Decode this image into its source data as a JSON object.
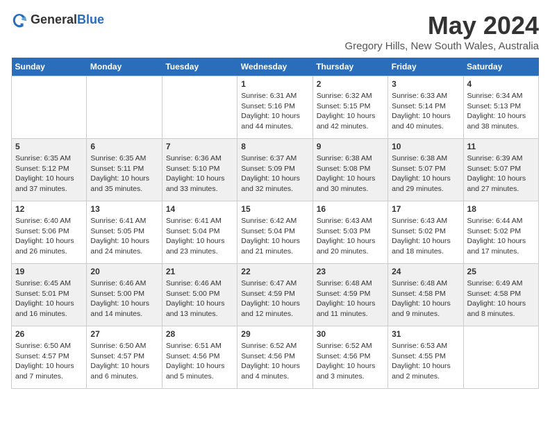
{
  "logo": {
    "general": "General",
    "blue": "Blue"
  },
  "title": "May 2024",
  "subtitle": "Gregory Hills, New South Wales, Australia",
  "headers": [
    "Sunday",
    "Monday",
    "Tuesday",
    "Wednesday",
    "Thursday",
    "Friday",
    "Saturday"
  ],
  "weeks": [
    [
      {
        "day": "",
        "info": ""
      },
      {
        "day": "",
        "info": ""
      },
      {
        "day": "",
        "info": ""
      },
      {
        "day": "1",
        "info": "Sunrise: 6:31 AM\nSunset: 5:16 PM\nDaylight: 10 hours\nand 44 minutes."
      },
      {
        "day": "2",
        "info": "Sunrise: 6:32 AM\nSunset: 5:15 PM\nDaylight: 10 hours\nand 42 minutes."
      },
      {
        "day": "3",
        "info": "Sunrise: 6:33 AM\nSunset: 5:14 PM\nDaylight: 10 hours\nand 40 minutes."
      },
      {
        "day": "4",
        "info": "Sunrise: 6:34 AM\nSunset: 5:13 PM\nDaylight: 10 hours\nand 38 minutes."
      }
    ],
    [
      {
        "day": "5",
        "info": "Sunrise: 6:35 AM\nSunset: 5:12 PM\nDaylight: 10 hours\nand 37 minutes."
      },
      {
        "day": "6",
        "info": "Sunrise: 6:35 AM\nSunset: 5:11 PM\nDaylight: 10 hours\nand 35 minutes."
      },
      {
        "day": "7",
        "info": "Sunrise: 6:36 AM\nSunset: 5:10 PM\nDaylight: 10 hours\nand 33 minutes."
      },
      {
        "day": "8",
        "info": "Sunrise: 6:37 AM\nSunset: 5:09 PM\nDaylight: 10 hours\nand 32 minutes."
      },
      {
        "day": "9",
        "info": "Sunrise: 6:38 AM\nSunset: 5:08 PM\nDaylight: 10 hours\nand 30 minutes."
      },
      {
        "day": "10",
        "info": "Sunrise: 6:38 AM\nSunset: 5:07 PM\nDaylight: 10 hours\nand 29 minutes."
      },
      {
        "day": "11",
        "info": "Sunrise: 6:39 AM\nSunset: 5:07 PM\nDaylight: 10 hours\nand 27 minutes."
      }
    ],
    [
      {
        "day": "12",
        "info": "Sunrise: 6:40 AM\nSunset: 5:06 PM\nDaylight: 10 hours\nand 26 minutes."
      },
      {
        "day": "13",
        "info": "Sunrise: 6:41 AM\nSunset: 5:05 PM\nDaylight: 10 hours\nand 24 minutes."
      },
      {
        "day": "14",
        "info": "Sunrise: 6:41 AM\nSunset: 5:04 PM\nDaylight: 10 hours\nand 23 minutes."
      },
      {
        "day": "15",
        "info": "Sunrise: 6:42 AM\nSunset: 5:04 PM\nDaylight: 10 hours\nand 21 minutes."
      },
      {
        "day": "16",
        "info": "Sunrise: 6:43 AM\nSunset: 5:03 PM\nDaylight: 10 hours\nand 20 minutes."
      },
      {
        "day": "17",
        "info": "Sunrise: 6:43 AM\nSunset: 5:02 PM\nDaylight: 10 hours\nand 18 minutes."
      },
      {
        "day": "18",
        "info": "Sunrise: 6:44 AM\nSunset: 5:02 PM\nDaylight: 10 hours\nand 17 minutes."
      }
    ],
    [
      {
        "day": "19",
        "info": "Sunrise: 6:45 AM\nSunset: 5:01 PM\nDaylight: 10 hours\nand 16 minutes."
      },
      {
        "day": "20",
        "info": "Sunrise: 6:46 AM\nSunset: 5:00 PM\nDaylight: 10 hours\nand 14 minutes."
      },
      {
        "day": "21",
        "info": "Sunrise: 6:46 AM\nSunset: 5:00 PM\nDaylight: 10 hours\nand 13 minutes."
      },
      {
        "day": "22",
        "info": "Sunrise: 6:47 AM\nSunset: 4:59 PM\nDaylight: 10 hours\nand 12 minutes."
      },
      {
        "day": "23",
        "info": "Sunrise: 6:48 AM\nSunset: 4:59 PM\nDaylight: 10 hours\nand 11 minutes."
      },
      {
        "day": "24",
        "info": "Sunrise: 6:48 AM\nSunset: 4:58 PM\nDaylight: 10 hours\nand 9 minutes."
      },
      {
        "day": "25",
        "info": "Sunrise: 6:49 AM\nSunset: 4:58 PM\nDaylight: 10 hours\nand 8 minutes."
      }
    ],
    [
      {
        "day": "26",
        "info": "Sunrise: 6:50 AM\nSunset: 4:57 PM\nDaylight: 10 hours\nand 7 minutes."
      },
      {
        "day": "27",
        "info": "Sunrise: 6:50 AM\nSunset: 4:57 PM\nDaylight: 10 hours\nand 6 minutes."
      },
      {
        "day": "28",
        "info": "Sunrise: 6:51 AM\nSunset: 4:56 PM\nDaylight: 10 hours\nand 5 minutes."
      },
      {
        "day": "29",
        "info": "Sunrise: 6:52 AM\nSunset: 4:56 PM\nDaylight: 10 hours\nand 4 minutes."
      },
      {
        "day": "30",
        "info": "Sunrise: 6:52 AM\nSunset: 4:56 PM\nDaylight: 10 hours\nand 3 minutes."
      },
      {
        "day": "31",
        "info": "Sunrise: 6:53 AM\nSunset: 4:55 PM\nDaylight: 10 hours\nand 2 minutes."
      },
      {
        "day": "",
        "info": ""
      }
    ]
  ]
}
